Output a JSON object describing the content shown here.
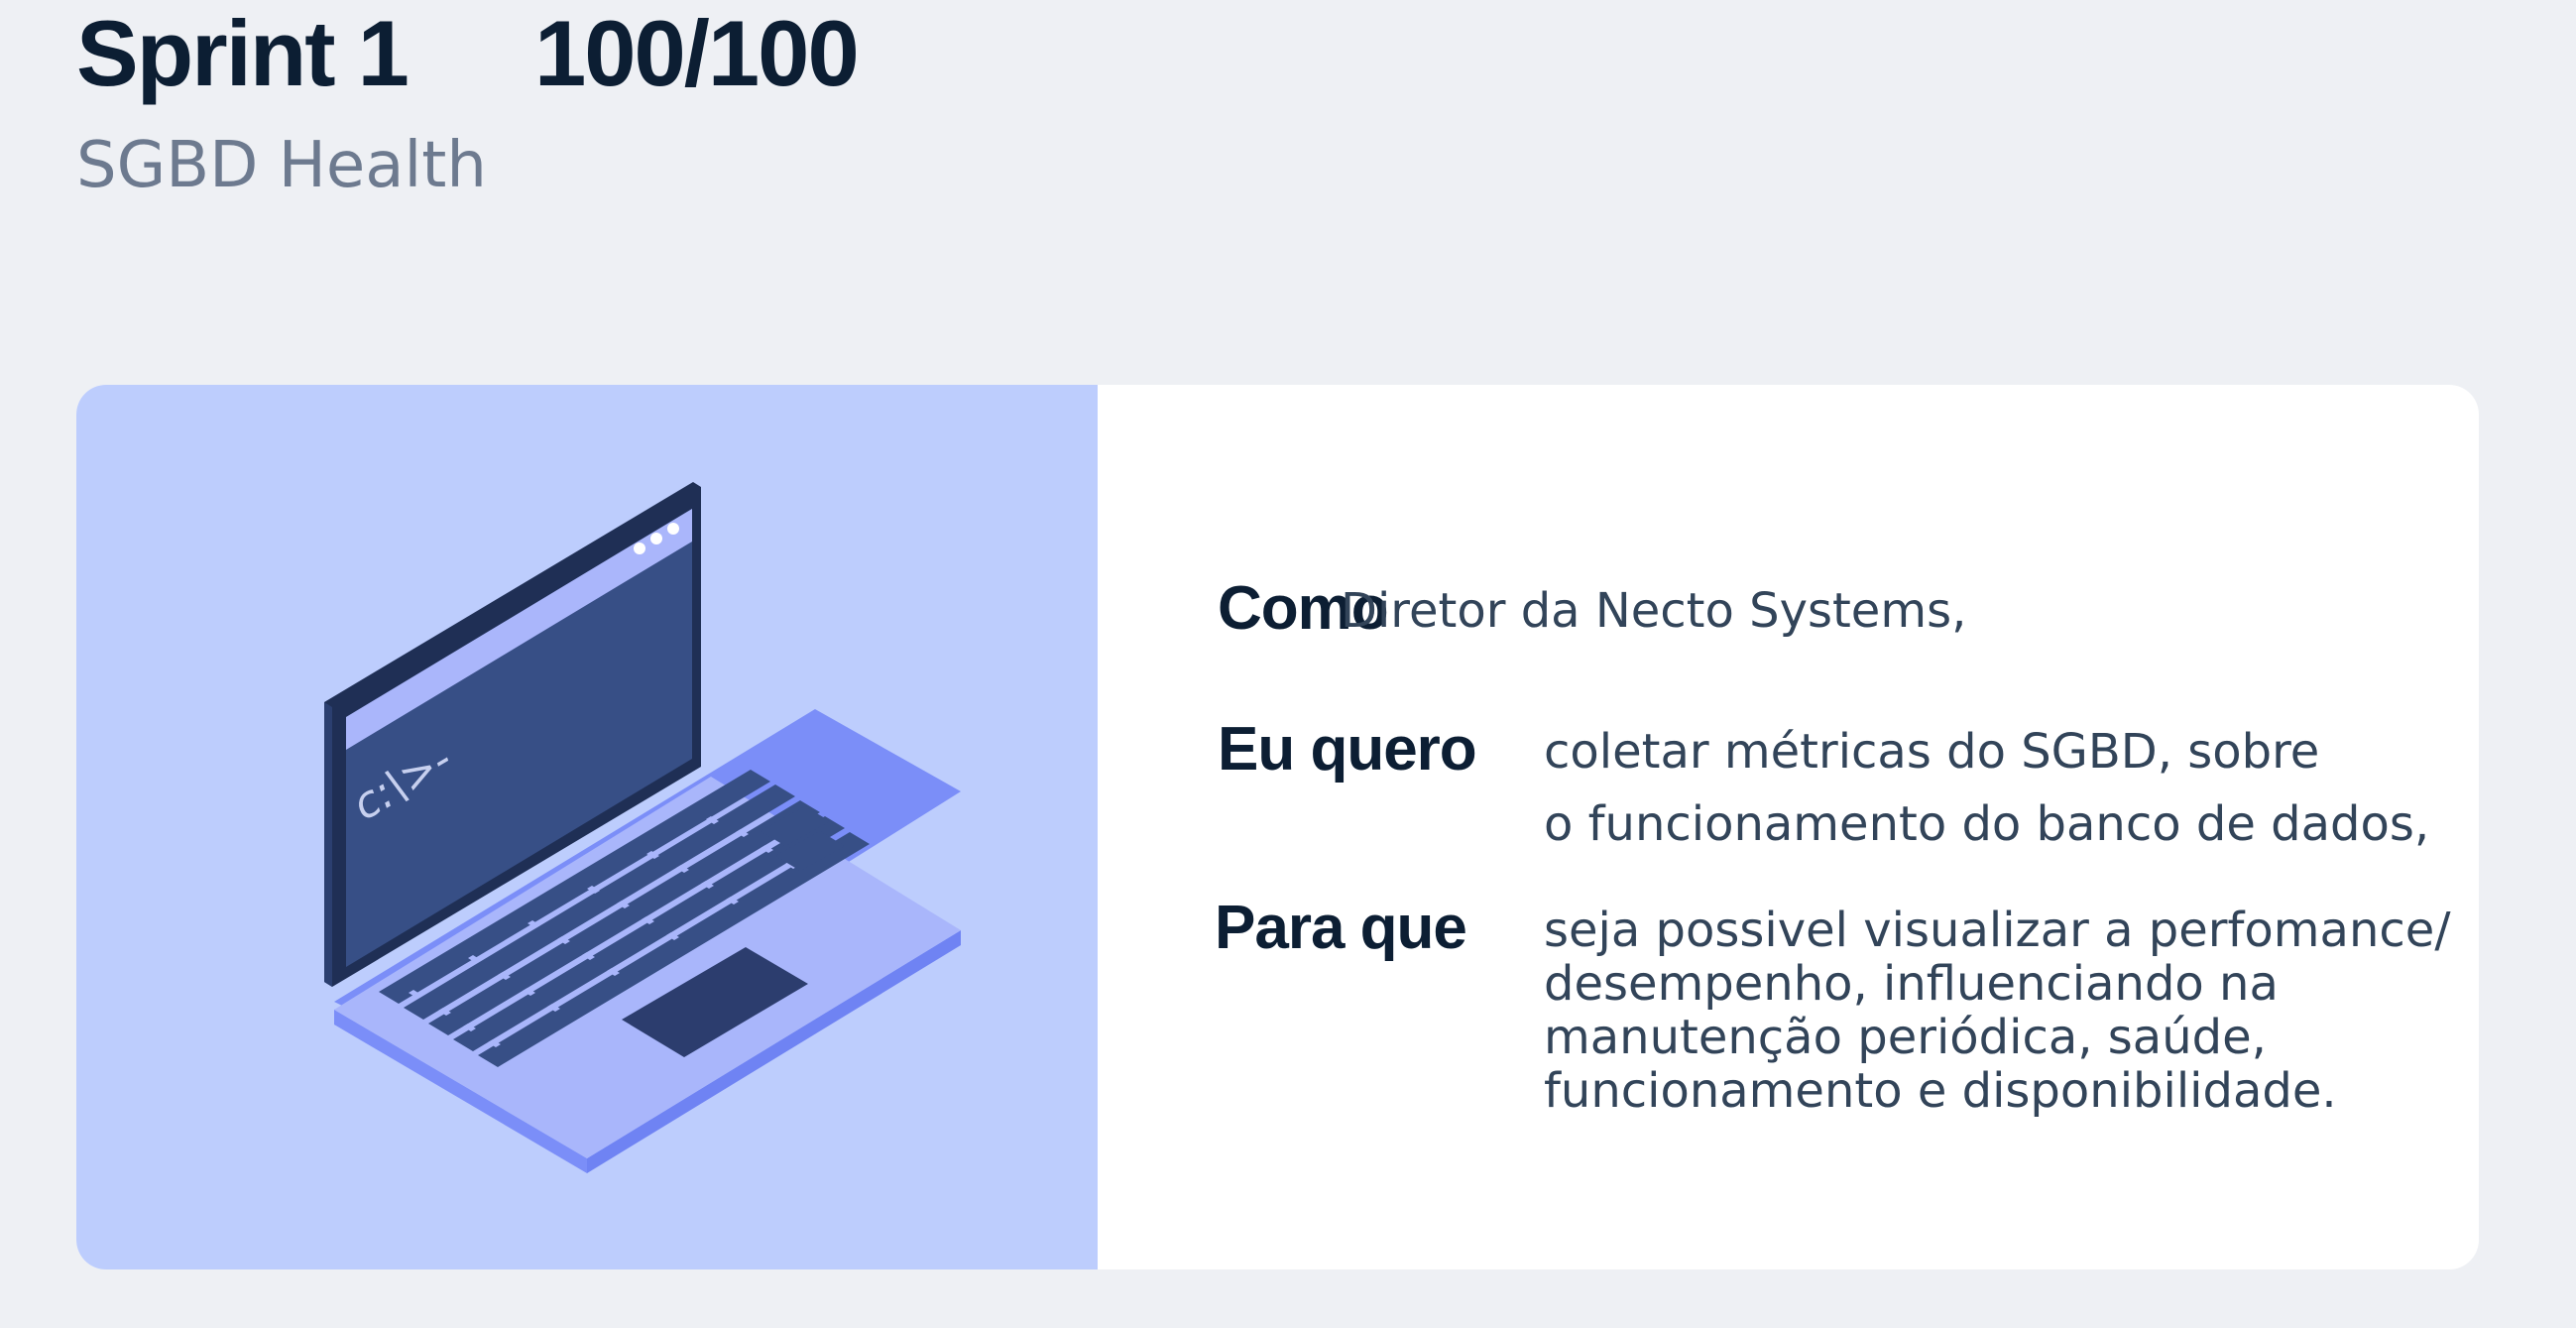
{
  "header": {
    "title": "Sprint 1",
    "score": "100/100",
    "subtitle": "SGBD Health"
  },
  "illustration": {
    "icon": "laptop-terminal-icon",
    "terminal_prompt": "c:\\>-",
    "colors": {
      "panel_bg": "#bdcdfd",
      "screen": "#374f86",
      "frame": "#1f2f55",
      "body": "#a7b5fb",
      "keys": "#374f86"
    }
  },
  "story": {
    "como_label": "Como",
    "como_text": "Diretor da Necto Systems,",
    "quero_label": "Eu quero",
    "quero_lines": [
      "coletar métricas do SGBD, sobre",
      "o funcionamento do banco  de dados,"
    ],
    "para_label": "Para que",
    "para_lines": [
      "seja possivel visualizar a perfomance/",
      "desempenho, influenciando na",
      "manutenção periódica, saúde,",
      "funcionamento e disponibilidade."
    ]
  }
}
